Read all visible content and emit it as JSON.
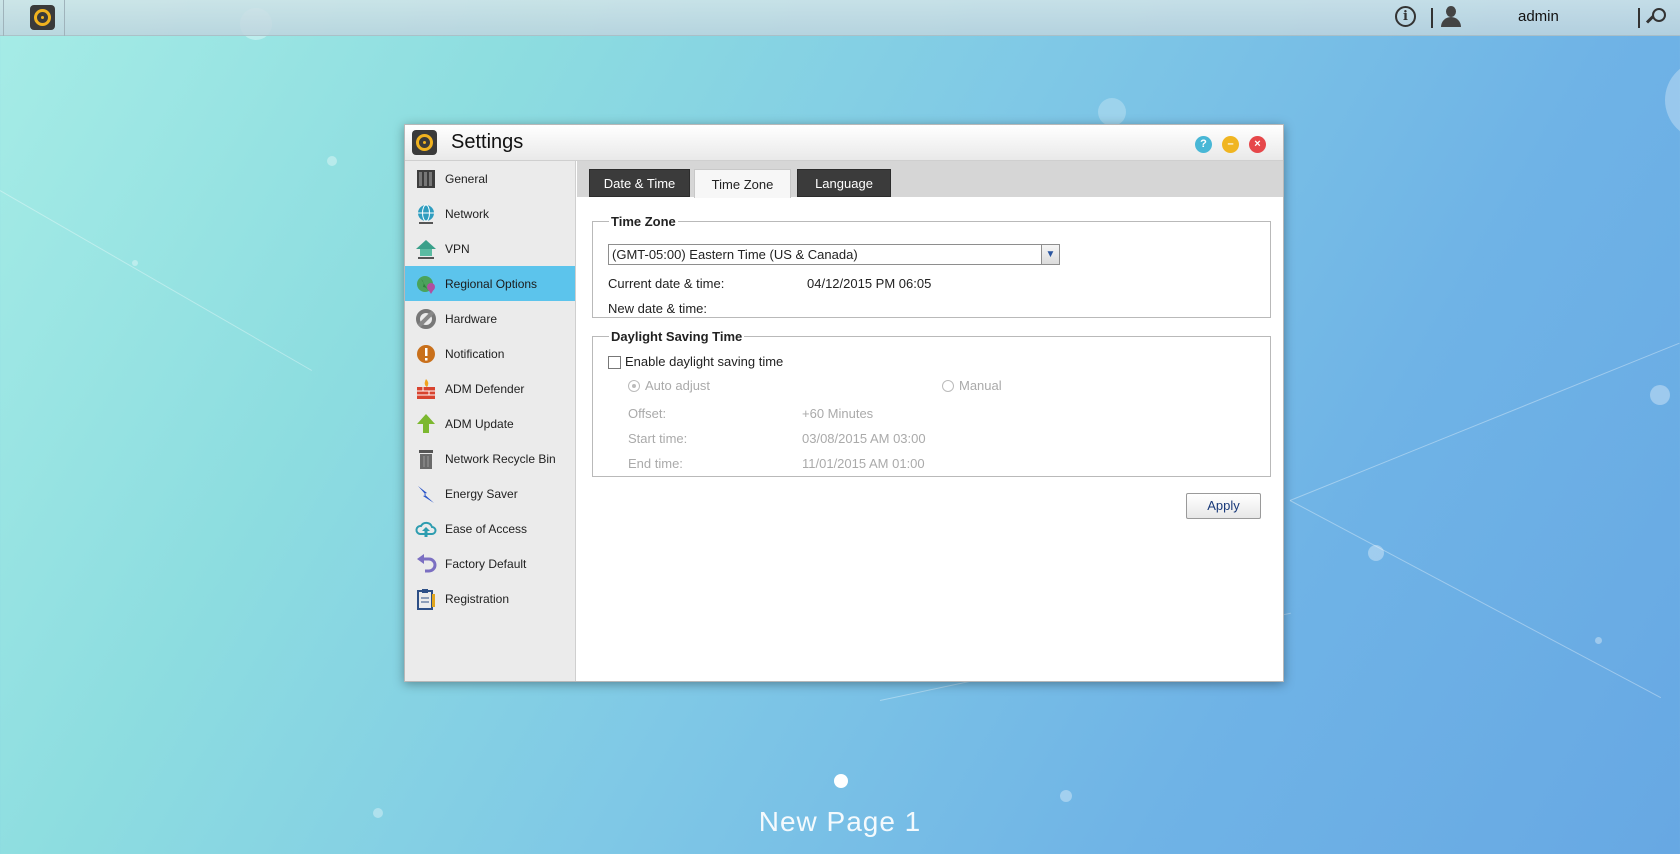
{
  "topbar": {
    "username": "admin",
    "info_glyph": "i",
    "icons": [
      "app-launcher-icon",
      "info-icon",
      "user-icon",
      "search-icon"
    ]
  },
  "window": {
    "title": "Settings",
    "controls": {
      "help": "?",
      "minimize": "–",
      "close": "×"
    }
  },
  "sidebar": {
    "items": [
      {
        "label": "General",
        "icon": "general-icon",
        "active": false
      },
      {
        "label": "Network",
        "icon": "network-icon",
        "active": false
      },
      {
        "label": "VPN",
        "icon": "vpn-icon",
        "active": false
      },
      {
        "label": "Regional Options",
        "icon": "regional-options-icon",
        "active": true
      },
      {
        "label": "Hardware",
        "icon": "hardware-icon",
        "active": false
      },
      {
        "label": "Notification",
        "icon": "notification-icon",
        "active": false
      },
      {
        "label": "ADM Defender",
        "icon": "defender-firewall-icon",
        "active": false
      },
      {
        "label": "ADM Update",
        "icon": "update-arrow-icon",
        "active": false
      },
      {
        "label": "Network Recycle Bin",
        "icon": "recycle-bin-icon",
        "active": false
      },
      {
        "label": "Energy Saver",
        "icon": "energy-bolt-icon",
        "active": false
      },
      {
        "label": "Ease of Access",
        "icon": "cloud-upload-icon",
        "active": false
      },
      {
        "label": "Factory Default",
        "icon": "undo-arrow-icon",
        "active": false
      },
      {
        "label": "Registration",
        "icon": "registration-clipboard-icon",
        "active": false
      }
    ]
  },
  "tabs": {
    "items": [
      {
        "label": "Date & Time",
        "active": false
      },
      {
        "label": "Time Zone",
        "active": true
      },
      {
        "label": "Language",
        "active": false
      }
    ]
  },
  "timezone": {
    "legend": "Time Zone",
    "selected": "(GMT-05:00) Eastern Time (US & Canada)",
    "arrow": "▼",
    "current_label": "Current date & time:",
    "current_value": "04/12/2015 PM 06:05",
    "new_label": "New date & time:",
    "new_value": ""
  },
  "dst": {
    "legend": "Daylight Saving Time",
    "enable_label": "Enable daylight saving time",
    "enabled": false,
    "auto_label": "Auto adjust",
    "manual_label": "Manual",
    "offset_label": "Offset:",
    "offset_value": "+60 Minutes",
    "start_label": "Start time:",
    "start_value": "03/08/2015 AM 03:00",
    "end_label": "End time:",
    "end_value": "11/01/2015 AM 01:00"
  },
  "apply_label": "Apply",
  "desktop": {
    "page_label": "New Page 1"
  }
}
